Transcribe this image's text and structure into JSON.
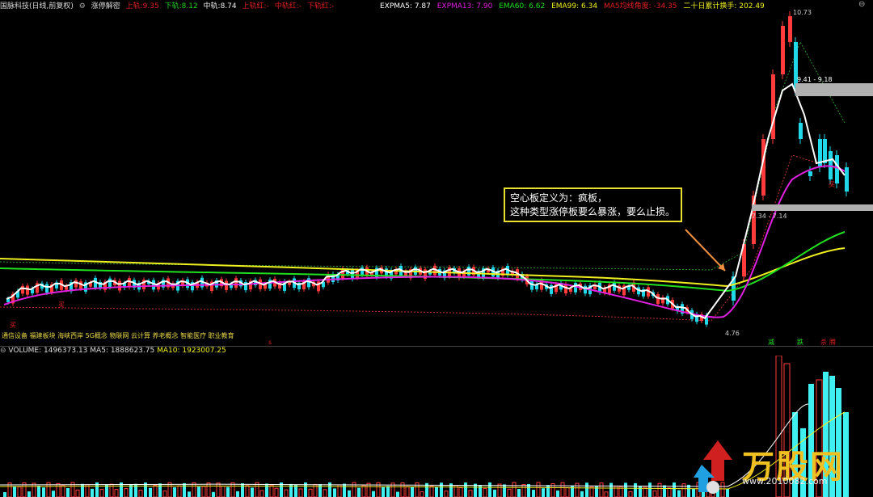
{
  "header": {
    "stock_title": "国脉科技(日线,前复权)",
    "indicator_name": "涨停解密",
    "up_label": "上轨:",
    "up_value": "9.35",
    "down_label": "下轨:",
    "down_value": "8.12",
    "mid_label": "中轨:",
    "mid_value": "8.74",
    "upper_red_label": "上轨红:",
    "upper_red_value": "-",
    "mid_red_label": "中轨红:",
    "mid_red_value": "-",
    "lower_red_label": "下轨红:",
    "lower_red_value": "-"
  },
  "indicators": {
    "expma5": "EXPMA5: 7.87",
    "expma13": "EXPMA13: 7.90",
    "ema60": "EMA60: 6.62",
    "ema99": "EMA99: 6.34",
    "ma5angle": "MA5均线角度: -34.35",
    "turnover": "二十日累计换手: 202.49"
  },
  "chart": {
    "high_label": "10.73",
    "low_label": "4.76",
    "range_label_top": "9.41 - 9.18",
    "range_label_bottom": "7.34 - 7.14",
    "buy_marks": [
      "买",
      "买",
      "买"
    ],
    "signal_labels": [
      "减",
      "跌",
      "杀",
      "腾"
    ],
    "marker_s": "s"
  },
  "callout": {
    "line1": "空心板定义为：疯板，",
    "line2": "这种类型涨停板要么暴涨，要么止损。"
  },
  "concepts": "通信设备 福建板块 海峡西岸 5G概念 物联网 云计算 养老概念 智能医疗 职业教育",
  "volume": {
    "label": "VOLUME: 1496373.13",
    "ma5": "MA5: 1888623.75",
    "ma10": "MA10: 1923007.25"
  },
  "watermark": {
    "text": "万股网",
    "url": "www.2010082.com"
  },
  "colors": {
    "up": "#ff3b3b",
    "down": "#20d8e8",
    "ma_white": "#ffffff",
    "ma_magenta": "#e020e0",
    "ma_green": "#20e020",
    "ma_yellow": "#f0f020",
    "volume_up": "#ff3b3b",
    "volume_down": "#40f0f0"
  }
}
